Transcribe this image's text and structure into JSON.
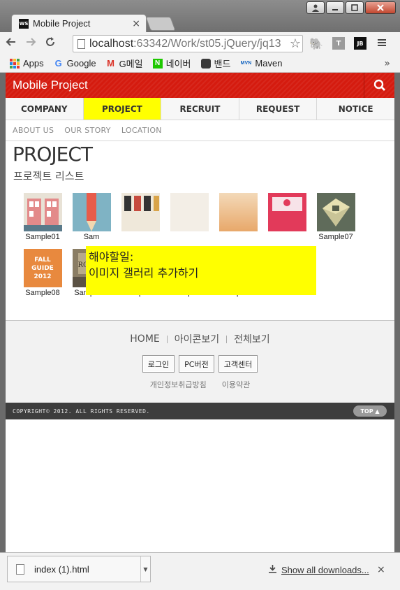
{
  "browser": {
    "tab_title": "Mobile Project",
    "tab_close": "×",
    "favicon_text": "WS",
    "url_host": "localhost",
    "url_path": ":63342/Work/st05.jQuery/jq13",
    "ext2": "T",
    "ext3": "JB",
    "bookmarks": [
      {
        "label": "Apps",
        "icon": "apps-grid-icon"
      },
      {
        "label": "Google",
        "icon": "google-icon"
      },
      {
        "label": "G메일",
        "icon": "gmail-icon"
      },
      {
        "label": "네이버",
        "icon": "naver-icon"
      },
      {
        "label": "밴드",
        "icon": "band-icon"
      },
      {
        "label": "Maven",
        "icon": "maven-icon"
      }
    ],
    "bookmarks_more": "»"
  },
  "site": {
    "title": "Mobile Project",
    "accent": "#d51b0f",
    "gnb": [
      {
        "label": "COMPANY",
        "active": false
      },
      {
        "label": "PROJECT",
        "active": true
      },
      {
        "label": "RECRUIT",
        "active": false
      },
      {
        "label": "REQUEST",
        "active": false
      },
      {
        "label": "NOTICE",
        "active": false
      }
    ],
    "lnb": [
      "ABOUT US",
      "OUR STORY",
      "LOCATION"
    ],
    "page_title": "PROJECT",
    "sub_title": "프로젝트 리스트",
    "gallery": [
      {
        "caption": "Sample01"
      },
      {
        "caption": "Sam"
      },
      {
        "caption": ""
      },
      {
        "caption": ""
      },
      {
        "caption": ""
      },
      {
        "caption": ""
      },
      {
        "caption": "Sample07"
      },
      {
        "caption": "Sample08"
      },
      {
        "caption": "Sample09"
      },
      {
        "caption": "Sample10"
      },
      {
        "caption": "Sample11"
      },
      {
        "caption": "Sample12"
      }
    ],
    "todo": {
      "line1": "해야할일:",
      "line2": "이미지 갤러리 추가하기"
    },
    "footer": {
      "links": [
        "HOME",
        "아이콘보기",
        "전체보기"
      ],
      "buttons": [
        "로그인",
        "PC버전",
        "고객센터"
      ],
      "policy": [
        "개인정보취급방침",
        "이용약관"
      ],
      "copyright": "COPYRIGHT© 2012. ALL RIGHTS RESERVED.",
      "top": "TOP ▲"
    }
  },
  "downloads": {
    "file_name": "index (1).html",
    "show_all": "Show all downloads...",
    "close": "×"
  }
}
